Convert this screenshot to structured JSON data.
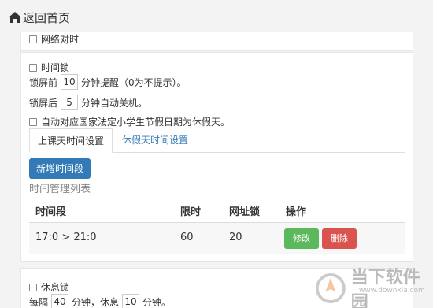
{
  "header": {
    "back_label": "返回首页"
  },
  "network_sync": {
    "label": "网络对时"
  },
  "time_lock": {
    "label": "时间锁",
    "remind_prefix": "锁屏前",
    "remind_value": "10",
    "remind_suffix": "分钟提醒（0为不提示）。",
    "shutdown_prefix": "锁屏后",
    "shutdown_value": "5",
    "shutdown_suffix": "分钟自动关机。",
    "holiday_label": "自动对应国家法定小学生节假日期为休假天。"
  },
  "tabs": [
    {
      "label": "上课天时间设置",
      "active": true
    },
    {
      "label": "休假天时间设置",
      "active": false
    }
  ],
  "add_button": "新增时间段",
  "table": {
    "title": "时间管理列表",
    "headers": [
      "时间段",
      "限时",
      "网址锁",
      "操作"
    ],
    "rows": [
      {
        "period": "17:0 > 21:0",
        "limit": "60",
        "url_lock": "20",
        "edit": "修改",
        "delete": "删除"
      }
    ]
  },
  "rest_lock": {
    "label": "休息锁",
    "every_prefix": "每隔",
    "every_value": "40",
    "rest_mid": "分钟，休息",
    "rest_value": "10",
    "rest_suffix": "分钟。"
  },
  "watermark": {
    "text": "当下软件园",
    "url": "www.downxia.com"
  },
  "colors": {
    "primary": "#337ab7",
    "success": "#5cb85c",
    "danger": "#d9534f"
  }
}
